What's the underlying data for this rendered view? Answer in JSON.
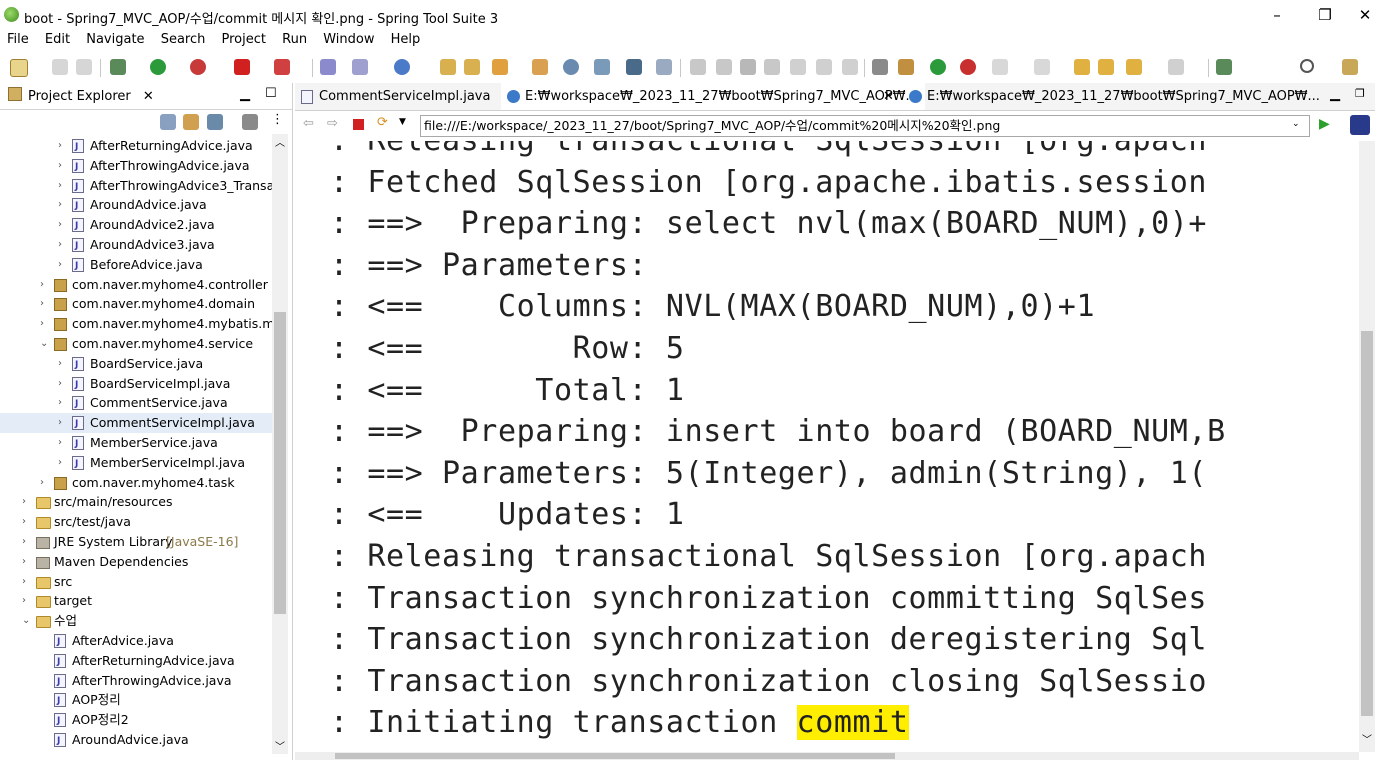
{
  "window": {
    "title": "boot - Spring7_MVC_AOP/수업/commit 메시지 확인.png - Spring Tool Suite 3",
    "controls": [
      "–",
      "❐",
      "✕"
    ]
  },
  "menu": [
    "File",
    "Edit",
    "Navigate",
    "Search",
    "Project",
    "Run",
    "Window",
    "Help"
  ],
  "explorer": {
    "tab_label": "Project Explorer",
    "tree": [
      {
        "indent": 2,
        "icon": "java",
        "label": "AfterReturningAdvice.java",
        "twisty": "›"
      },
      {
        "indent": 2,
        "icon": "java",
        "label": "AfterThrowingAdvice.java",
        "twisty": "›"
      },
      {
        "indent": 2,
        "icon": "java",
        "label": "AfterThrowingAdvice3_Transa",
        "twisty": "›"
      },
      {
        "indent": 2,
        "icon": "java",
        "label": "AroundAdvice.java",
        "twisty": "›"
      },
      {
        "indent": 2,
        "icon": "java",
        "label": "AroundAdvice2.java",
        "twisty": "›"
      },
      {
        "indent": 2,
        "icon": "java",
        "label": "AroundAdvice3.java",
        "twisty": "›"
      },
      {
        "indent": 2,
        "icon": "java",
        "label": "BeforeAdvice.java",
        "twisty": "›"
      },
      {
        "indent": 1,
        "icon": "pkg",
        "label": "com.naver.myhome4.controller",
        "twisty": "›"
      },
      {
        "indent": 1,
        "icon": "pkg",
        "label": "com.naver.myhome4.domain",
        "twisty": "›"
      },
      {
        "indent": 1,
        "icon": "pkg",
        "label": "com.naver.myhome4.mybatis.m",
        "twisty": "›"
      },
      {
        "indent": 1,
        "icon": "pkg",
        "label": "com.naver.myhome4.service",
        "twisty": "⌄"
      },
      {
        "indent": 2,
        "icon": "java",
        "label": "BoardService.java",
        "twisty": "›"
      },
      {
        "indent": 2,
        "icon": "java",
        "label": "BoardServiceImpl.java",
        "twisty": "›"
      },
      {
        "indent": 2,
        "icon": "java",
        "label": "CommentService.java",
        "twisty": "›"
      },
      {
        "indent": 2,
        "icon": "java",
        "label": "CommentServiceImpl.java",
        "twisty": "›",
        "selected": true
      },
      {
        "indent": 2,
        "icon": "java",
        "label": "MemberService.java",
        "twisty": "›"
      },
      {
        "indent": 2,
        "icon": "java",
        "label": "MemberServiceImpl.java",
        "twisty": "›"
      },
      {
        "indent": 1,
        "icon": "pkg",
        "label": "com.naver.myhome4.task",
        "twisty": "›"
      },
      {
        "indent": 0,
        "icon": "folder",
        "label": "src/main/resources",
        "twisty": "›"
      },
      {
        "indent": 0,
        "icon": "folder",
        "label": "src/test/java",
        "twisty": "›"
      },
      {
        "indent": 0,
        "icon": "lib",
        "label": "JRE System Library",
        "suffix": "[JavaSE-16]",
        "twisty": "›"
      },
      {
        "indent": 0,
        "icon": "lib",
        "label": "Maven Dependencies",
        "twisty": "›"
      },
      {
        "indent": 0,
        "icon": "folder",
        "label": "src",
        "twisty": "›"
      },
      {
        "indent": 0,
        "icon": "folder",
        "label": "target",
        "twisty": "›"
      },
      {
        "indent": 0,
        "icon": "folder",
        "label": "수업",
        "twisty": "⌄"
      },
      {
        "indent": 1,
        "icon": "java",
        "label": "AfterAdvice.java",
        "twisty": ""
      },
      {
        "indent": 1,
        "icon": "java",
        "label": "AfterReturningAdvice.java",
        "twisty": ""
      },
      {
        "indent": 1,
        "icon": "java",
        "label": "AfterThrowingAdvice.java",
        "twisty": ""
      },
      {
        "indent": 1,
        "icon": "java",
        "label": "AOP정리",
        "twisty": ""
      },
      {
        "indent": 1,
        "icon": "java",
        "label": "AOP정리2",
        "twisty": ""
      },
      {
        "indent": 1,
        "icon": "java",
        "label": "AroundAdvice.java",
        "twisty": ""
      }
    ]
  },
  "editor": {
    "tabs": [
      {
        "label": "CommentServiceImpl.java",
        "active": false
      },
      {
        "label": "E:₩workspace₩_2023_11_27₩boot₩Spring7_MVC_AOP₩...",
        "active": true
      },
      {
        "label": "E:₩workspace₩_2023_11_27₩boot₩Spring7_MVC_AOP₩...",
        "active": false
      }
    ],
    "url": "file:///E:/workspace/_2023_11_27/boot/Spring7_MVC_AOP/수업/commit%20메시지%20확인.png"
  },
  "log": {
    "lines": [
      ": Releasing transactional SqlSession [org.apach",
      ": Fetched SqlSession [org.apache.ibatis.session",
      ": ==>  Preparing: select nvl(max(BOARD_NUM),0)+",
      ": ==> Parameters:",
      ": <==    Columns: NVL(MAX(BOARD_NUM),0)+1",
      ": <==        Row: 5",
      ": <==      Total: 1",
      ": ==>  Preparing: insert into board (BOARD_NUM,B",
      ": ==> Parameters: 5(Integer), admin(String), 1(",
      ": <==    Updates: 1",
      ": Releasing transactional SqlSession [org.apach",
      ": Transaction synchronization committing SqlSes",
      ": Transaction synchronization deregistering Sql",
      ": Transaction synchronization closing SqlSessio"
    ],
    "last_prefix": ": Initiating transaction ",
    "last_highlight": "commit"
  }
}
